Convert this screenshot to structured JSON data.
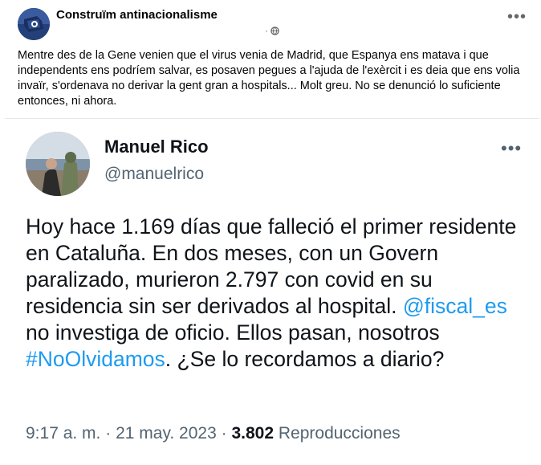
{
  "fb_post": {
    "author": "Construïm antinacionalisme",
    "meta_dot": "·",
    "privacy_icon": "globe-icon",
    "more_icon": "more-icon",
    "more_glyph": "•••",
    "text": "Mentre des de la Gene venien que el virus venia de Madrid, que Espanya ens matava i que independents ens podríem salvar, es posaven pegues a l'ajuda de l'exèrcit i es deia que ens volia invaïr, s'ordenava no derivar la gent gran a hospitals... Molt greu. No se denunció lo suficiente entonces, ni ahora."
  },
  "tweet": {
    "name": "Manuel Rico",
    "handle": "@manuelrico",
    "more_glyph": "•••",
    "text_1": "Hoy hace 1.169 días que falleció el primer residente en Cataluña. En dos meses, con un Govern paralizado, murieron 2.797 con covid en su residencia sin ser derivados al hospital. ",
    "mention": "@fiscal_es",
    "text_2": " no investiga de oficio. Ellos pasan, nosotros ",
    "hashtag": "#NoOlvidamos",
    "text_3": ". ¿Se lo recordamos a diario?",
    "time": "9:17 a. m.",
    "sep": "·",
    "date": "21 may. 2023",
    "views_count": "3.802",
    "views_label": "Reproducciones"
  },
  "colors": {
    "link": "#1d9bf0",
    "secondary_text": "#536471",
    "fb_secondary": "#65676b"
  }
}
